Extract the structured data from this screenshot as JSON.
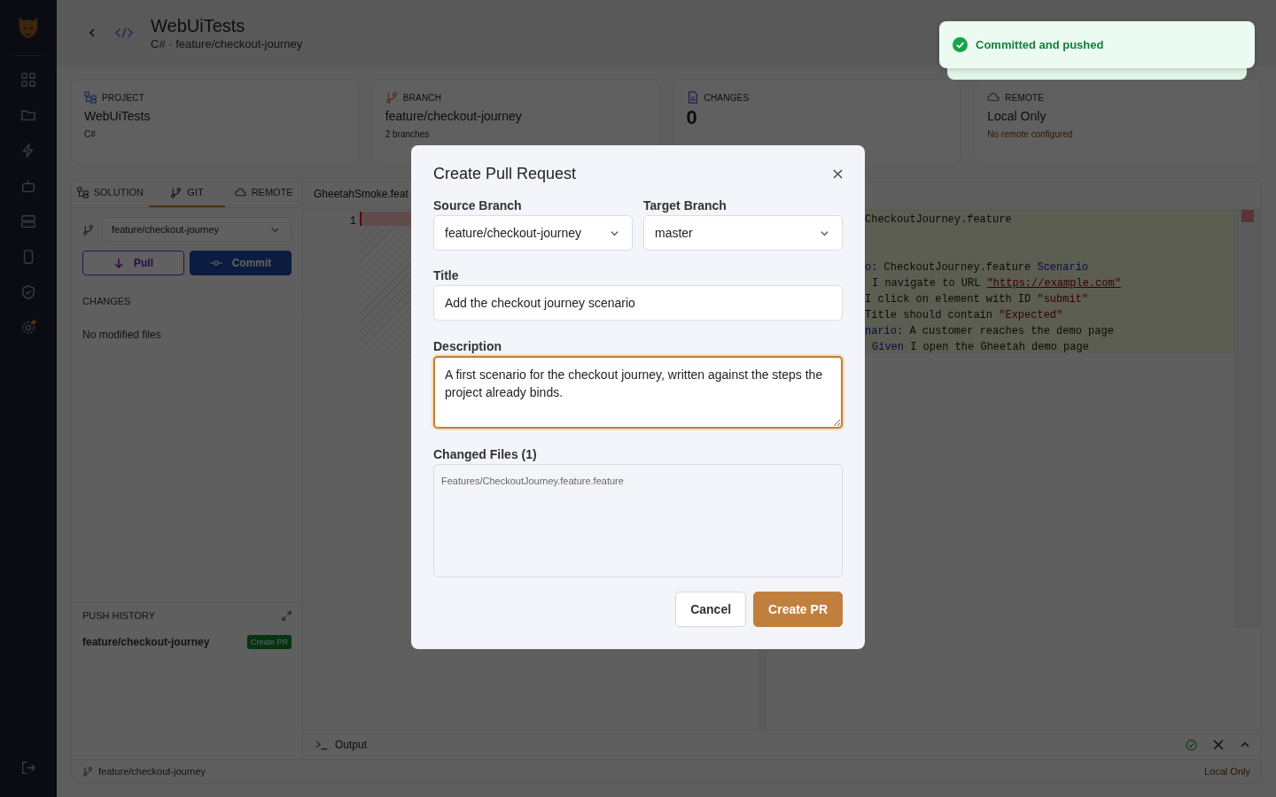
{
  "sidebar": {
    "items": [
      {
        "kind": "dashboard",
        "has_dot": false
      },
      {
        "kind": "folder",
        "has_dot": false
      },
      {
        "kind": "bolt",
        "has_dot": false
      },
      {
        "kind": "robot",
        "has_dot": false
      },
      {
        "kind": "server",
        "has_dot": false
      },
      {
        "kind": "device",
        "has_dot": false
      },
      {
        "kind": "shield",
        "has_dot": false
      },
      {
        "kind": "settings",
        "has_dot": true
      }
    ]
  },
  "header": {
    "title": "WebUiTests",
    "subtitle": "C# · feature/checkout-journey"
  },
  "stats": [
    {
      "kind": "project",
      "label": "PROJECT",
      "value": "WebUiTests",
      "note": "C#"
    },
    {
      "kind": "branch",
      "label": "BRANCH",
      "value": "feature/checkout-journey",
      "note": "2 branches"
    },
    {
      "kind": "changes",
      "label": "CHANGES",
      "value": "0"
    },
    {
      "kind": "remote",
      "label": "REMOTE",
      "value": "Local Only",
      "note": "No remote configured"
    }
  ],
  "panel_tabs": [
    {
      "kind": "solution",
      "label": "SOLUTION",
      "selected": false
    },
    {
      "kind": "git",
      "label": "GIT",
      "selected": true
    },
    {
      "kind": "remote",
      "label": "REMOTE",
      "selected": false
    }
  ],
  "git": {
    "branch": "feature/checkout-journey",
    "pull": "Pull",
    "commit": "Commit",
    "changes_heading": "CHANGES",
    "empty": "No modified files",
    "push_history": {
      "heading": "PUSH HISTORY",
      "entries": [
        {
          "branch": "feature/checkout-journey",
          "action": "Create PR"
        }
      ]
    }
  },
  "editor": {
    "file_tab": "GheetahSmoke.feat",
    "line_number": "1",
    "code": [
      [
        {
          "text": "CheckoutJourney.feature",
          "kind": "plain"
        }
      ],
      [
        {
          "text": "o:",
          "kind": "keyword"
        },
        {
          "text": " CheckoutJourney.feature ",
          "kind": "plain"
        },
        {
          "text": "Scenario",
          "kind": "keyword"
        }
      ],
      [
        {
          "text": "I navigate to URL ",
          "kind": "plain"
        },
        {
          "text": "\"https://example.com\"",
          "kind": "link"
        }
      ],
      [
        {
          "text": "I click on element with ID ",
          "kind": "plain"
        },
        {
          "text": "\"submit\"",
          "kind": "string"
        }
      ],
      [
        {
          "text": "Title should contain ",
          "kind": "plain"
        },
        {
          "text": "\"Expected\"",
          "kind": "string"
        }
      ],
      [
        {
          "text": "nario:",
          "kind": "keyword"
        },
        {
          "text": " A customer reaches the demo page",
          "kind": "plain"
        }
      ],
      [
        {
          "text": "Given",
          "kind": "keyword"
        },
        {
          "text": " I open the Gheetah demo page",
          "kind": "plain"
        }
      ]
    ]
  },
  "output": {
    "label": "Output"
  },
  "status_bar": {
    "branch": "feature/checkout-journey",
    "remote": "Local Only"
  },
  "toast": {
    "kind": "success",
    "message": "Committed and pushed"
  },
  "modal": {
    "title": "Create Pull Request",
    "source": {
      "label": "Source Branch",
      "value": "feature/checkout-journey"
    },
    "target": {
      "label": "Target Branch",
      "value": "master"
    },
    "pr_title": {
      "label": "Title",
      "value": "Add the checkout journey scenario"
    },
    "description": {
      "label": "Description",
      "value": "A first scenario for the checkout journey, written against the steps the project already binds.",
      "focused": true
    },
    "changed_files": {
      "label": "Changed Files (1)",
      "files": [
        "Features/CheckoutJourney.feature.feature"
      ]
    },
    "cancel": "Cancel",
    "submit": "Create PR"
  }
}
